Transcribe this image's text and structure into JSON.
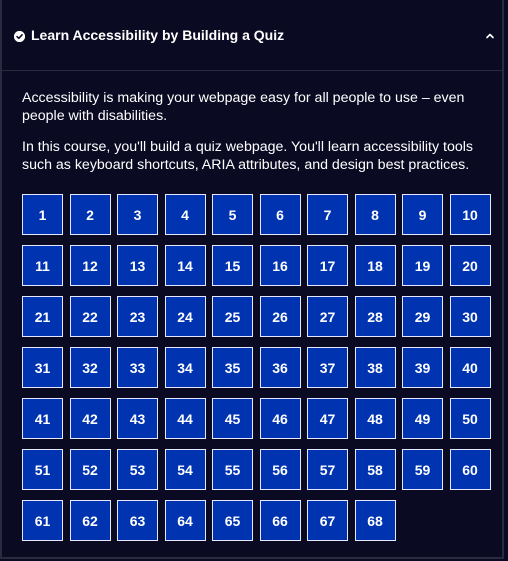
{
  "header": {
    "title": "Learn Accessibility by Building a Quiz",
    "status_icon": "check-circle-icon",
    "toggle_icon": "chevron-up-icon"
  },
  "description": {
    "paragraph1": "Accessibility is making your webpage easy for all people to use – even people with disabilities.",
    "paragraph2": "In this course, you'll build a quiz webpage. You'll learn accessibility tools such as keyboard shortcuts, ARIA attributes, and design best practices."
  },
  "steps": [
    "1",
    "2",
    "3",
    "4",
    "5",
    "6",
    "7",
    "8",
    "9",
    "10",
    "11",
    "12",
    "13",
    "14",
    "15",
    "16",
    "17",
    "18",
    "19",
    "20",
    "21",
    "22",
    "23",
    "24",
    "25",
    "26",
    "27",
    "28",
    "29",
    "30",
    "31",
    "32",
    "33",
    "34",
    "35",
    "36",
    "37",
    "38",
    "39",
    "40",
    "41",
    "42",
    "43",
    "44",
    "45",
    "46",
    "47",
    "48",
    "49",
    "50",
    "51",
    "52",
    "53",
    "54",
    "55",
    "56",
    "57",
    "58",
    "59",
    "60",
    "61",
    "62",
    "63",
    "64",
    "65",
    "66",
    "67",
    "68"
  ],
  "colors": {
    "background": "#0a0a23",
    "step_fill": "#0033b0",
    "step_border": "#e6e6ff",
    "text": "#ffffff"
  }
}
